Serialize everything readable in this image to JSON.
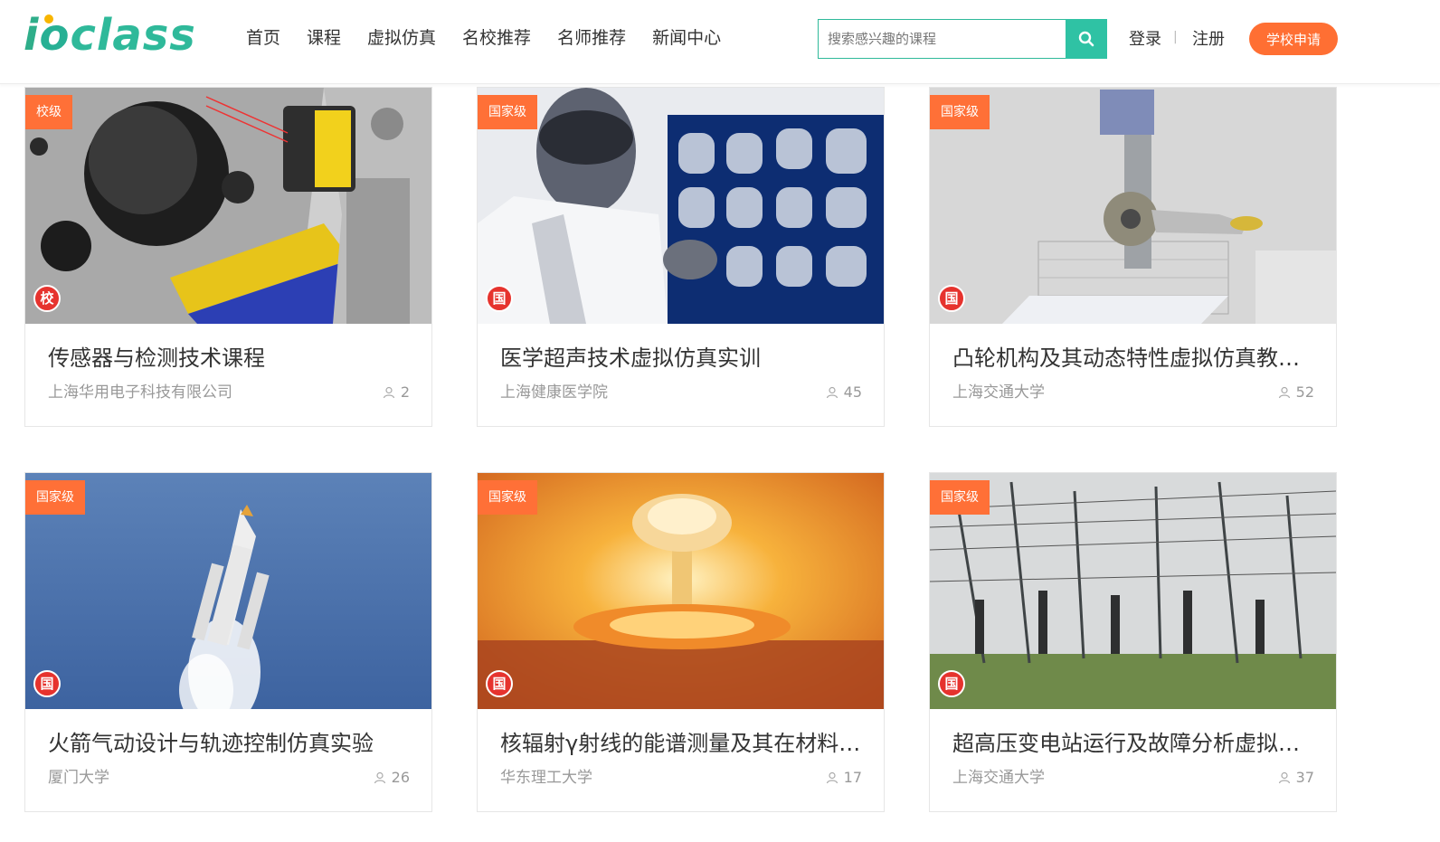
{
  "header": {
    "logo_text": "ioclass",
    "nav": [
      "首页",
      "课程",
      "虚拟仿真",
      "名校推荐",
      "名师推荐",
      "新闻中心"
    ],
    "search_placeholder": "搜索感兴趣的课程",
    "login": "登录",
    "separator": "|",
    "register": "注册",
    "apply": "学校申请"
  },
  "cards": [
    {
      "badge": "校级",
      "mark": "校",
      "title": "传感器与检测技术课程",
      "school": "上海华用电子科技有限公司",
      "count": "2"
    },
    {
      "badge": "国家级",
      "mark": "国",
      "title": "医学超声技术虚拟仿真实训",
      "school": "上海健康医学院",
      "count": "45"
    },
    {
      "badge": "国家级",
      "mark": "国",
      "title": "凸轮机构及其动态特性虚拟仿真教学实验",
      "school": "上海交通大学",
      "count": "52"
    },
    {
      "badge": "国家级",
      "mark": "国",
      "title": "火箭气动设计与轨迹控制仿真实验",
      "school": "厦门大学",
      "count": "26"
    },
    {
      "badge": "国家级",
      "mark": "国",
      "title": "核辐射γ射线的能谱测量及其在材料分析中的应用",
      "school": "华东理工大学",
      "count": "17"
    },
    {
      "badge": "国家级",
      "mark": "国",
      "title": "超高压变电站运行及故障分析虚拟仿真实验",
      "school": "上海交通大学",
      "count": "37"
    }
  ],
  "colors": {
    "brand": "#2fb99a",
    "accent": "#ff6f33",
    "badge": "#ff7037",
    "mark": "#e6332e"
  }
}
